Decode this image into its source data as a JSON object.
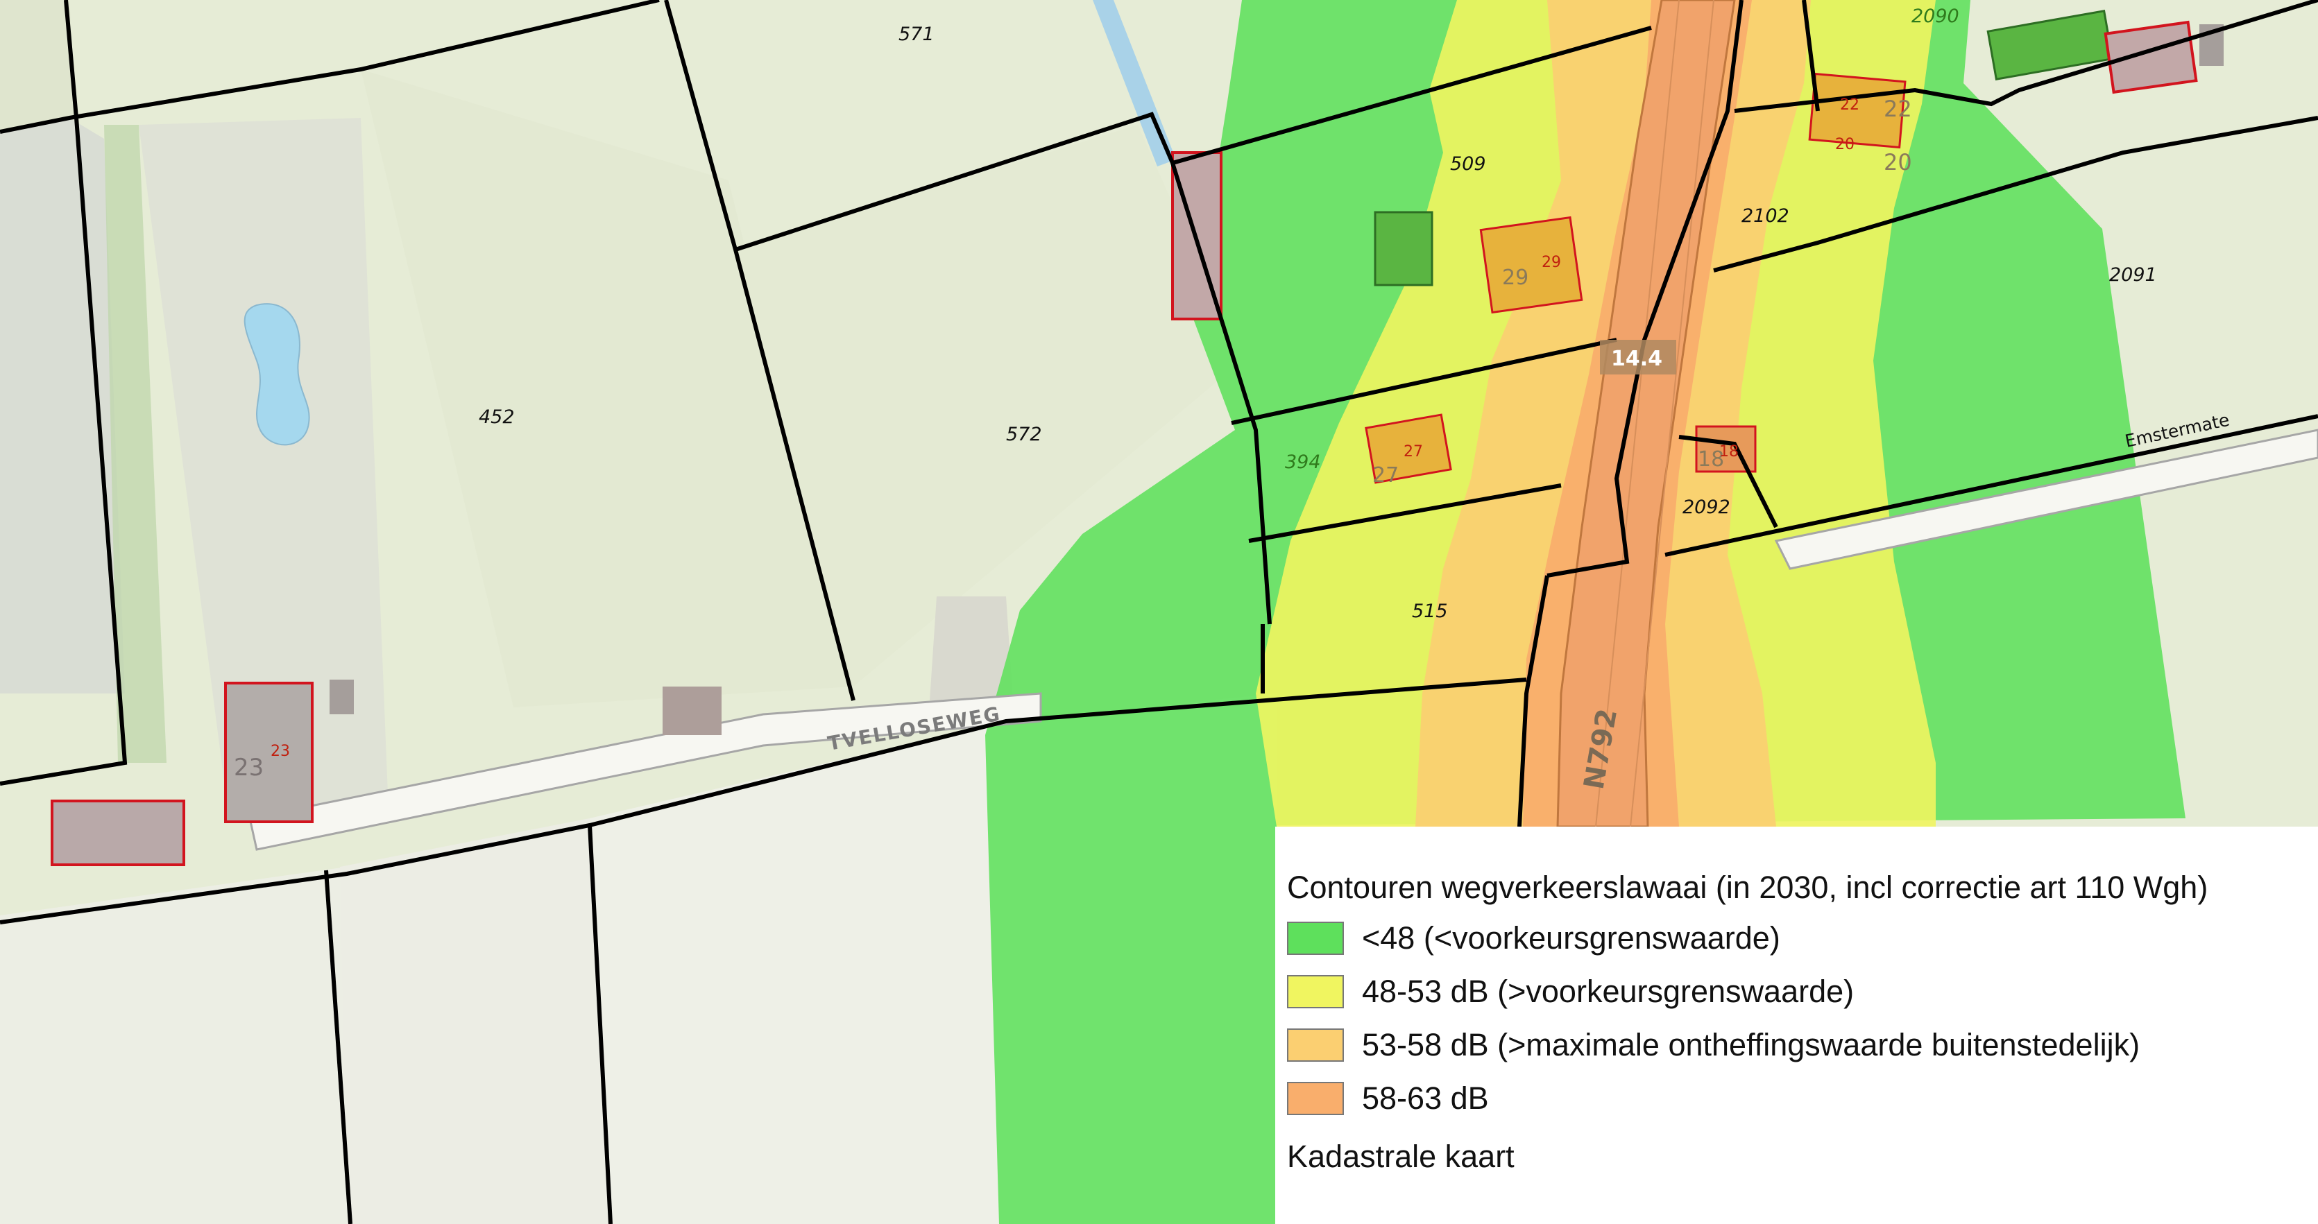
{
  "map": {
    "parcel_numbers": [
      "571",
      "452",
      "572",
      "509",
      "394",
      "515",
      "2090",
      "2102",
      "2091",
      "2092"
    ],
    "house_numbers": {
      "h23": "23",
      "h23_red": "23",
      "h29": "29",
      "h29_red": "29",
      "h27": "27",
      "h27_red": "27",
      "h18": "18",
      "h18_red": "18",
      "h22": "22",
      "h22_red": "22",
      "h20": "20",
      "h20_red": "20"
    },
    "streets": {
      "tvelloseweg": "TVELLOSEWEG",
      "emstermate": "Emstermate",
      "n792": "N792"
    },
    "road_badge": "14.4"
  },
  "legend": {
    "title": "Contouren wegverkeerslawaai  (in 2030, incl correctie art 110 Wgh)",
    "items": [
      {
        "label": "<48 (<voorkeursgrenswaarde)",
        "color": "#5ee05c"
      },
      {
        "label": "48-53 dB (>voorkeursgrenswaarde)",
        "color": "#f0f560"
      },
      {
        "label": "53-58 dB (>maximale ontheffingswaarde buitenstedelijk)",
        "color": "#fbcf71"
      },
      {
        "label": "58-63 dB",
        "color": "#f9ae6c"
      }
    ],
    "subtitle": "Kadastrale kaart"
  },
  "colors": {
    "parcel_boundary": "#000000",
    "building_outline": "#d2141e",
    "background": "#e9efdd"
  }
}
